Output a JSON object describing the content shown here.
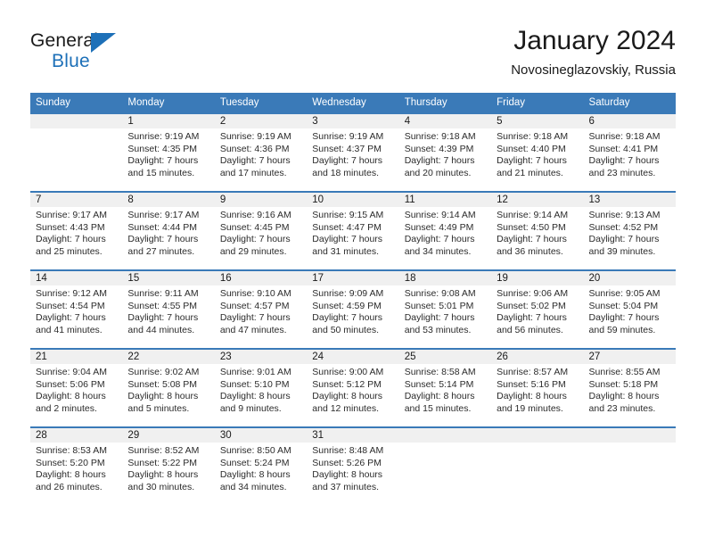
{
  "brand": {
    "name_top": "General",
    "name_bottom": "Blue",
    "accent_color": "#1d70b8"
  },
  "header": {
    "title": "January 2024",
    "subtitle": "Novosineglazovskiy, Russia"
  },
  "theme": {
    "header_bg": "#3a7ab8",
    "header_text": "#ffffff",
    "daynum_band_bg": "#f0f0f0",
    "week_separator": "#3a7ab8"
  },
  "weekdays": [
    "Sunday",
    "Monday",
    "Tuesday",
    "Wednesday",
    "Thursday",
    "Friday",
    "Saturday"
  ],
  "weeks": [
    [
      {
        "day": "",
        "sunrise": "",
        "sunset": "",
        "daylight1": "",
        "daylight2": ""
      },
      {
        "day": "1",
        "sunrise": "Sunrise: 9:19 AM",
        "sunset": "Sunset: 4:35 PM",
        "daylight1": "Daylight: 7 hours",
        "daylight2": "and 15 minutes."
      },
      {
        "day": "2",
        "sunrise": "Sunrise: 9:19 AM",
        "sunset": "Sunset: 4:36 PM",
        "daylight1": "Daylight: 7 hours",
        "daylight2": "and 17 minutes."
      },
      {
        "day": "3",
        "sunrise": "Sunrise: 9:19 AM",
        "sunset": "Sunset: 4:37 PM",
        "daylight1": "Daylight: 7 hours",
        "daylight2": "and 18 minutes."
      },
      {
        "day": "4",
        "sunrise": "Sunrise: 9:18 AM",
        "sunset": "Sunset: 4:39 PM",
        "daylight1": "Daylight: 7 hours",
        "daylight2": "and 20 minutes."
      },
      {
        "day": "5",
        "sunrise": "Sunrise: 9:18 AM",
        "sunset": "Sunset: 4:40 PM",
        "daylight1": "Daylight: 7 hours",
        "daylight2": "and 21 minutes."
      },
      {
        "day": "6",
        "sunrise": "Sunrise: 9:18 AM",
        "sunset": "Sunset: 4:41 PM",
        "daylight1": "Daylight: 7 hours",
        "daylight2": "and 23 minutes."
      }
    ],
    [
      {
        "day": "7",
        "sunrise": "Sunrise: 9:17 AM",
        "sunset": "Sunset: 4:43 PM",
        "daylight1": "Daylight: 7 hours",
        "daylight2": "and 25 minutes."
      },
      {
        "day": "8",
        "sunrise": "Sunrise: 9:17 AM",
        "sunset": "Sunset: 4:44 PM",
        "daylight1": "Daylight: 7 hours",
        "daylight2": "and 27 minutes."
      },
      {
        "day": "9",
        "sunrise": "Sunrise: 9:16 AM",
        "sunset": "Sunset: 4:45 PM",
        "daylight1": "Daylight: 7 hours",
        "daylight2": "and 29 minutes."
      },
      {
        "day": "10",
        "sunrise": "Sunrise: 9:15 AM",
        "sunset": "Sunset: 4:47 PM",
        "daylight1": "Daylight: 7 hours",
        "daylight2": "and 31 minutes."
      },
      {
        "day": "11",
        "sunrise": "Sunrise: 9:14 AM",
        "sunset": "Sunset: 4:49 PM",
        "daylight1": "Daylight: 7 hours",
        "daylight2": "and 34 minutes."
      },
      {
        "day": "12",
        "sunrise": "Sunrise: 9:14 AM",
        "sunset": "Sunset: 4:50 PM",
        "daylight1": "Daylight: 7 hours",
        "daylight2": "and 36 minutes."
      },
      {
        "day": "13",
        "sunrise": "Sunrise: 9:13 AM",
        "sunset": "Sunset: 4:52 PM",
        "daylight1": "Daylight: 7 hours",
        "daylight2": "and 39 minutes."
      }
    ],
    [
      {
        "day": "14",
        "sunrise": "Sunrise: 9:12 AM",
        "sunset": "Sunset: 4:54 PM",
        "daylight1": "Daylight: 7 hours",
        "daylight2": "and 41 minutes."
      },
      {
        "day": "15",
        "sunrise": "Sunrise: 9:11 AM",
        "sunset": "Sunset: 4:55 PM",
        "daylight1": "Daylight: 7 hours",
        "daylight2": "and 44 minutes."
      },
      {
        "day": "16",
        "sunrise": "Sunrise: 9:10 AM",
        "sunset": "Sunset: 4:57 PM",
        "daylight1": "Daylight: 7 hours",
        "daylight2": "and 47 minutes."
      },
      {
        "day": "17",
        "sunrise": "Sunrise: 9:09 AM",
        "sunset": "Sunset: 4:59 PM",
        "daylight1": "Daylight: 7 hours",
        "daylight2": "and 50 minutes."
      },
      {
        "day": "18",
        "sunrise": "Sunrise: 9:08 AM",
        "sunset": "Sunset: 5:01 PM",
        "daylight1": "Daylight: 7 hours",
        "daylight2": "and 53 minutes."
      },
      {
        "day": "19",
        "sunrise": "Sunrise: 9:06 AM",
        "sunset": "Sunset: 5:02 PM",
        "daylight1": "Daylight: 7 hours",
        "daylight2": "and 56 minutes."
      },
      {
        "day": "20",
        "sunrise": "Sunrise: 9:05 AM",
        "sunset": "Sunset: 5:04 PM",
        "daylight1": "Daylight: 7 hours",
        "daylight2": "and 59 minutes."
      }
    ],
    [
      {
        "day": "21",
        "sunrise": "Sunrise: 9:04 AM",
        "sunset": "Sunset: 5:06 PM",
        "daylight1": "Daylight: 8 hours",
        "daylight2": "and 2 minutes."
      },
      {
        "day": "22",
        "sunrise": "Sunrise: 9:02 AM",
        "sunset": "Sunset: 5:08 PM",
        "daylight1": "Daylight: 8 hours",
        "daylight2": "and 5 minutes."
      },
      {
        "day": "23",
        "sunrise": "Sunrise: 9:01 AM",
        "sunset": "Sunset: 5:10 PM",
        "daylight1": "Daylight: 8 hours",
        "daylight2": "and 9 minutes."
      },
      {
        "day": "24",
        "sunrise": "Sunrise: 9:00 AM",
        "sunset": "Sunset: 5:12 PM",
        "daylight1": "Daylight: 8 hours",
        "daylight2": "and 12 minutes."
      },
      {
        "day": "25",
        "sunrise": "Sunrise: 8:58 AM",
        "sunset": "Sunset: 5:14 PM",
        "daylight1": "Daylight: 8 hours",
        "daylight2": "and 15 minutes."
      },
      {
        "day": "26",
        "sunrise": "Sunrise: 8:57 AM",
        "sunset": "Sunset: 5:16 PM",
        "daylight1": "Daylight: 8 hours",
        "daylight2": "and 19 minutes."
      },
      {
        "day": "27",
        "sunrise": "Sunrise: 8:55 AM",
        "sunset": "Sunset: 5:18 PM",
        "daylight1": "Daylight: 8 hours",
        "daylight2": "and 23 minutes."
      }
    ],
    [
      {
        "day": "28",
        "sunrise": "Sunrise: 8:53 AM",
        "sunset": "Sunset: 5:20 PM",
        "daylight1": "Daylight: 8 hours",
        "daylight2": "and 26 minutes."
      },
      {
        "day": "29",
        "sunrise": "Sunrise: 8:52 AM",
        "sunset": "Sunset: 5:22 PM",
        "daylight1": "Daylight: 8 hours",
        "daylight2": "and 30 minutes."
      },
      {
        "day": "30",
        "sunrise": "Sunrise: 8:50 AM",
        "sunset": "Sunset: 5:24 PM",
        "daylight1": "Daylight: 8 hours",
        "daylight2": "and 34 minutes."
      },
      {
        "day": "31",
        "sunrise": "Sunrise: 8:48 AM",
        "sunset": "Sunset: 5:26 PM",
        "daylight1": "Daylight: 8 hours",
        "daylight2": "and 37 minutes."
      },
      {
        "day": "",
        "sunrise": "",
        "sunset": "",
        "daylight1": "",
        "daylight2": ""
      },
      {
        "day": "",
        "sunrise": "",
        "sunset": "",
        "daylight1": "",
        "daylight2": ""
      },
      {
        "day": "",
        "sunrise": "",
        "sunset": "",
        "daylight1": "",
        "daylight2": ""
      }
    ]
  ]
}
